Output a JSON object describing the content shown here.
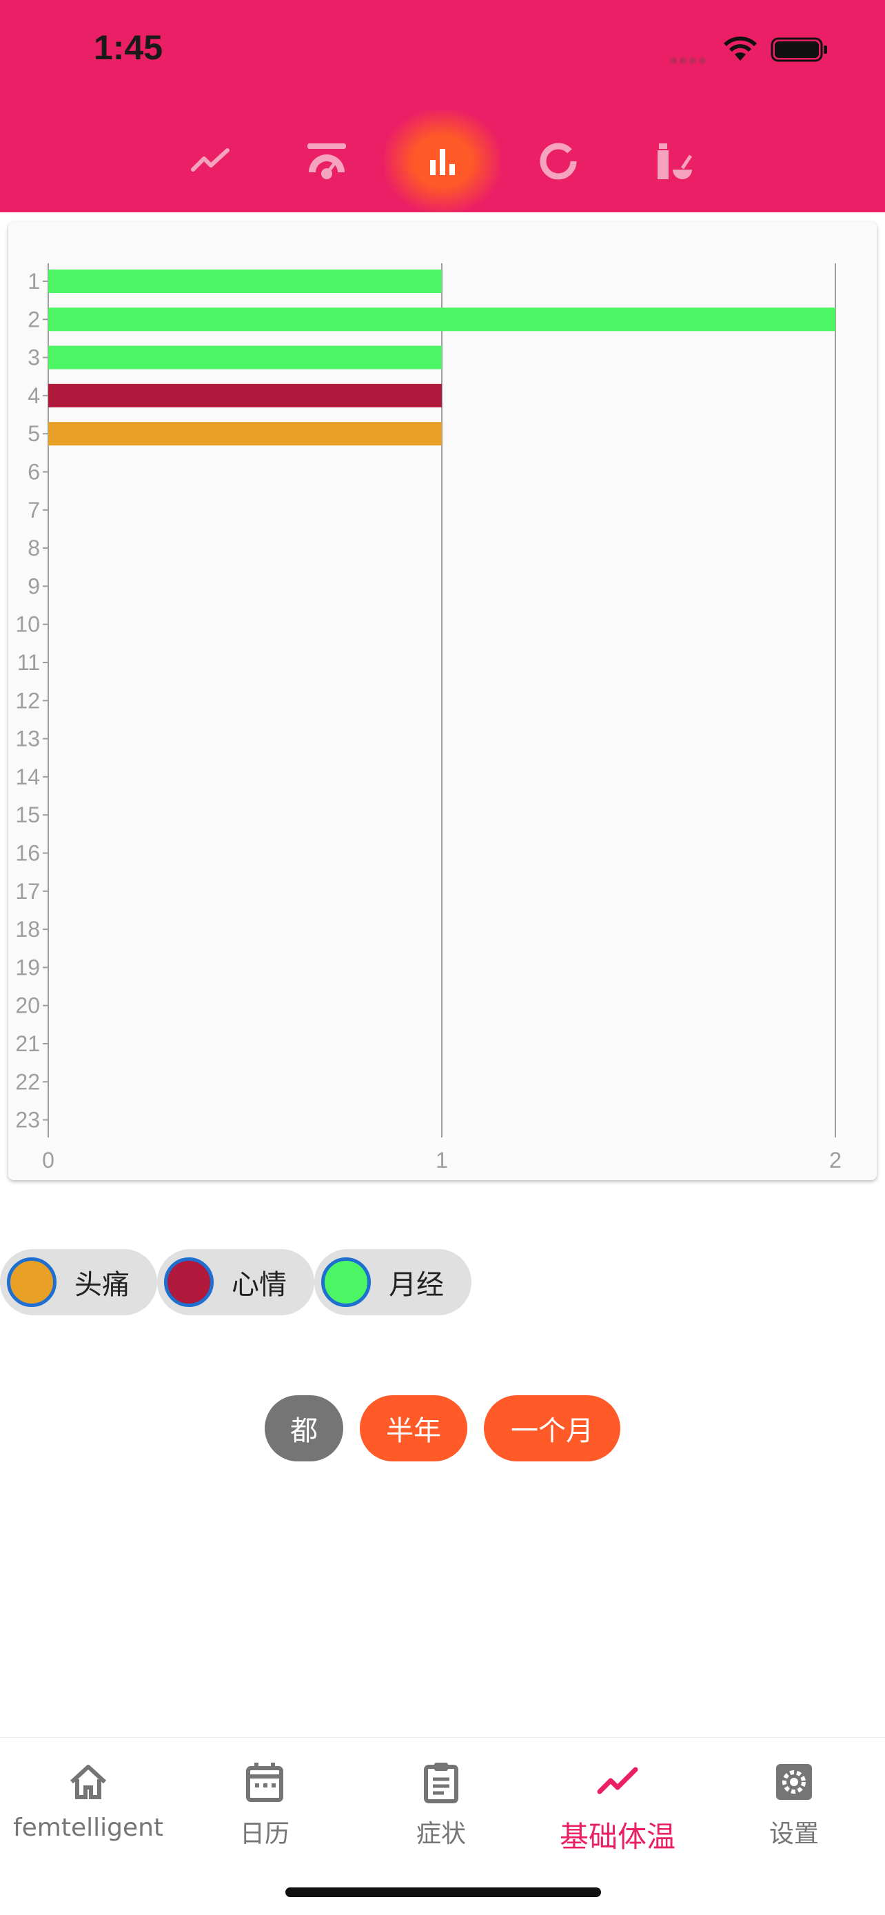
{
  "status_bar": {
    "time": "1:45"
  },
  "top_tabs": [
    {
      "icon": "line-chart-icon"
    },
    {
      "icon": "gauge-icon"
    },
    {
      "icon": "bar-chart-icon",
      "active": true
    },
    {
      "icon": "donut-chart-icon"
    },
    {
      "icon": "medicine-icon"
    }
  ],
  "colors": {
    "header": "#EA1F66",
    "active_tab": "#FF5A27",
    "headache": "#E8A027",
    "mood": "#B0183C",
    "period": "#4CF564",
    "chip_border": "#1E6FD0",
    "all_button": "#757575",
    "range_button": "#FF5A27"
  },
  "chart_data": {
    "type": "bar",
    "orientation": "horizontal",
    "categories": [
      "1",
      "2",
      "3",
      "4",
      "5",
      "6",
      "7",
      "8",
      "9",
      "10",
      "11",
      "12",
      "13",
      "14",
      "15",
      "16",
      "17",
      "18",
      "19",
      "20",
      "21",
      "22",
      "23"
    ],
    "bars": [
      {
        "category": "1",
        "value": 1,
        "series": "月经"
      },
      {
        "category": "2",
        "value": 2,
        "series": "月经"
      },
      {
        "category": "3",
        "value": 1,
        "series": "月经"
      },
      {
        "category": "4",
        "value": 1,
        "series": "心情"
      },
      {
        "category": "5",
        "value": 1,
        "series": "头痛"
      }
    ],
    "xticks": [
      "0",
      "1",
      "2"
    ],
    "xlim": [
      0,
      2
    ],
    "grid": true
  },
  "legend": [
    {
      "label": "头痛",
      "color": "#E8A027"
    },
    {
      "label": "心情",
      "color": "#B0183C"
    },
    {
      "label": "月经",
      "color": "#4CF564"
    }
  ],
  "range_buttons": [
    {
      "label": "都"
    },
    {
      "label": "半年"
    },
    {
      "label": "一个月"
    }
  ],
  "bottom_nav": [
    {
      "label": "femtelligent",
      "icon": "home-icon"
    },
    {
      "label": "日历",
      "icon": "calendar-icon"
    },
    {
      "label": "症状",
      "icon": "clipboard-icon"
    },
    {
      "label": "基础体温",
      "icon": "trend-icon",
      "active": true
    },
    {
      "label": "设置",
      "icon": "settings-icon"
    }
  ]
}
